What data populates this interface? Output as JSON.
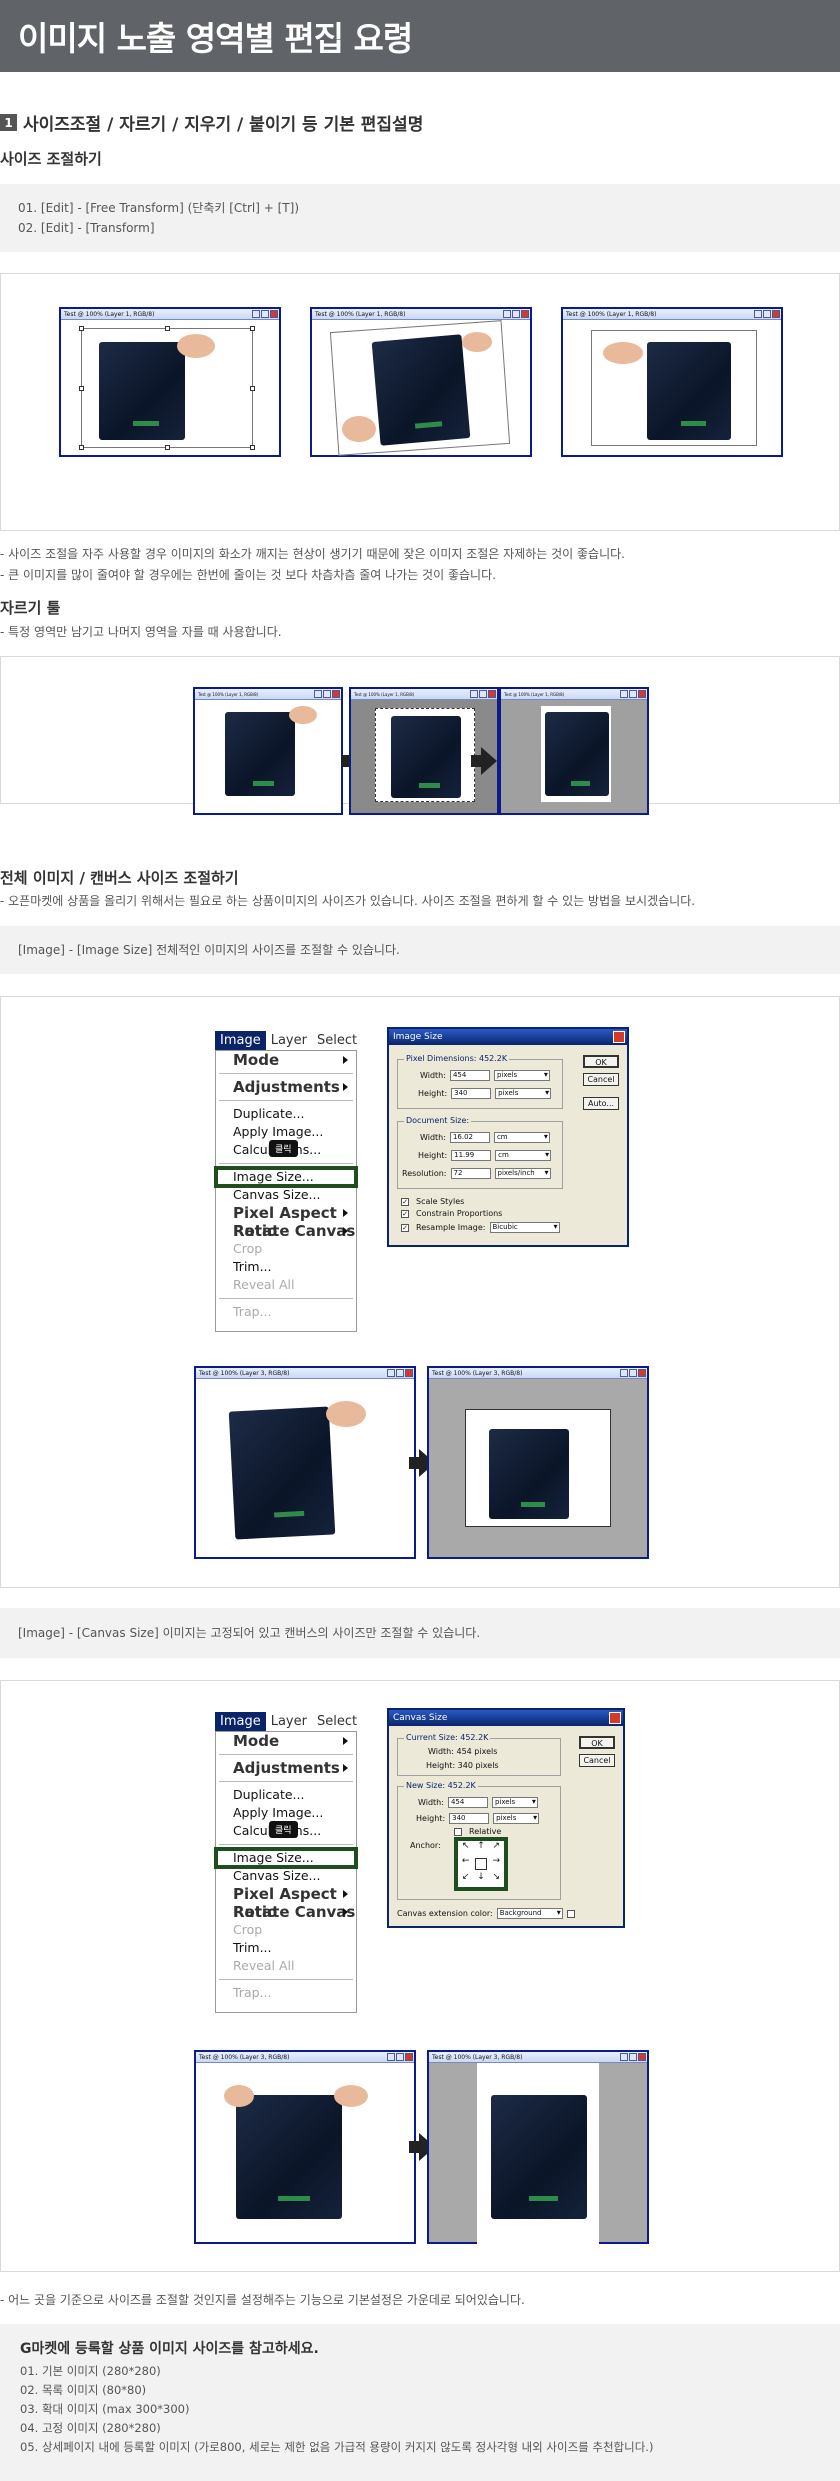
{
  "header": {
    "title": "이미지 노출 영역별 편집 요령"
  },
  "section1": {
    "number": "1",
    "title": "사이즈조절 / 자르기 / 지우기 / 붙이기 등 기본 편집설명"
  },
  "resize": {
    "title": "사이즈 조절하기",
    "steps": [
      "01. [Edit] - [Free Transform] (단축키 [Ctrl] + [T])",
      "02. [Edit] - [Transform]"
    ],
    "notes": [
      "- 사이즈 조절을 자주 사용할 경우 이미지의 화소가 깨지는 현상이 생기기 때문에 잦은 이미지 조절은 자제하는 것이 좋습니다.",
      "- 큰 이미지를 많이 줄여야 할 경우에는 한번에 줄이는 것 보다 차츰차츰 줄여 나가는 것이 좋습니다."
    ]
  },
  "crop": {
    "title": "자르기 툴",
    "note": "- 특정 영역만 남기고 나머지 영역을 자를 때 사용합니다."
  },
  "canvas_section": {
    "title": "전체 이미지 / 캔버스 사이즈 조절하기",
    "note": "- 오픈마켓에 상품을 올리기 위해서는 필요로 하는 상품이미지의 사이즈가 있습니다. 사이즈 조절을 편하게 할 수 있는 방법을 보시겠습니다.",
    "image_size_tip": "[Image] - [Image Size] 전체적인 이미지의 사이즈를 조절할 수 있습니다.",
    "canvas_size_tip": "[Image] - [Canvas Size] 이미지는 고정되어 있고 캔버스의 사이즈만 조절할 수 있습니다.",
    "anchor_note": "- 어느 곳을 기준으로 사이즈를 조절할 것인지를 설정해주는 기능으로 기본설정은 가운데로 되어있습니다."
  },
  "window_titles": {
    "layer1": "Test @ 100% (Layer 1, RGB/8)",
    "layer3": "Test @ 100% (Layer 3, RGB/8)"
  },
  "menu": {
    "bar": [
      "Image",
      "Layer",
      "Select"
    ],
    "items": [
      "Mode",
      "Adjustments",
      "Duplicate...",
      "Apply Image...",
      "Calculations...",
      "Image Size...",
      "Canvas Size...",
      "Pixel Aspect Ratio",
      "Rotate Canvas",
      "Crop",
      "Trim...",
      "Reveal All",
      "Trap..."
    ],
    "click_tag": "클릭"
  },
  "image_size_dialog": {
    "title": "Image Size",
    "pixel_dimensions": "Pixel Dimensions:  452.2K",
    "width_label": "Width:",
    "width_value": "454",
    "width_unit": "pixels",
    "height_label": "Height:",
    "height_value": "340",
    "height_unit": "pixels",
    "document_size": "Document Size:",
    "doc_width_value": "16.02",
    "doc_width_unit": "cm",
    "doc_height_value": "11.99",
    "doc_height_unit": "cm",
    "resolution_label": "Resolution:",
    "resolution_value": "72",
    "resolution_unit": "pixels/inch",
    "scale_styles": "Scale Styles",
    "constrain": "Constrain Proportions",
    "resample": "Resample Image:",
    "resample_value": "Bicubic",
    "ok": "OK",
    "cancel": "Cancel",
    "auto": "Auto..."
  },
  "canvas_size_dialog": {
    "title": "Canvas Size",
    "current_size": "Current Size: 452.2K",
    "cur_width": "Width:  454 pixels",
    "cur_height": "Height:  340 pixels",
    "new_size": "New Size: 452.2K",
    "width_label": "Width:",
    "width_value": "454",
    "width_unit": "pixels",
    "height_label": "Height:",
    "height_value": "340",
    "height_unit": "pixels",
    "relative": "Relative",
    "anchor": "Anchor:",
    "ext_color_label": "Canvas extension color:",
    "ext_color_value": "Background",
    "ok": "OK",
    "cancel": "Cancel"
  },
  "gmarket": {
    "title": "G마켓에 등록할 상품 이미지 사이즈를 참고하세요.",
    "items": [
      "01. 기본 이미지 (280*280)",
      "02. 목록 이미지 (80*80)",
      "03. 확대 이미지 (max 300*300)",
      "04. 고정 이미지 (280*280)",
      "05. 상세페이지 내에 등록할 이미지 (가로800, 세로는 제한 없음 가급적 용량이 커지지 않도록 정사각형 내외 사이즈를 추천합니다.)"
    ]
  }
}
